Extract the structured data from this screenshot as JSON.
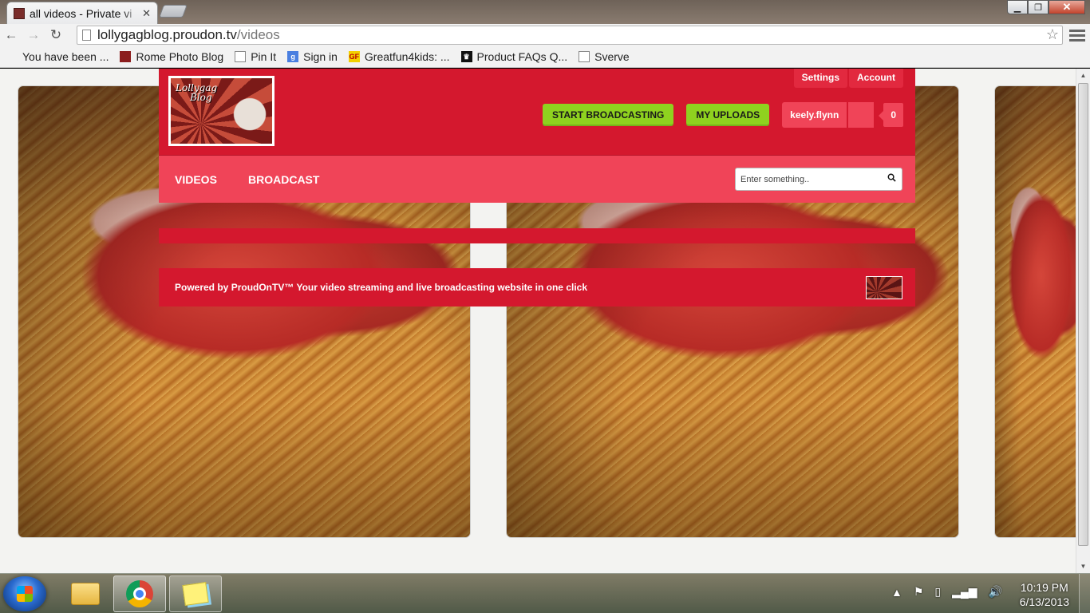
{
  "browser": {
    "tab_title": "all videos - Private vi",
    "tab_close": "✕",
    "url_host": "lollygagblog.proudon.tv",
    "url_path": "/videos",
    "window_close": "✕",
    "window_min": "▁",
    "window_max": "❐"
  },
  "bookmarks": [
    {
      "label": "You have been ...",
      "icon": "none"
    },
    {
      "label": "Rome Photo Blog",
      "icon": "photo-icon"
    },
    {
      "label": "Pin It",
      "icon": "page-icon"
    },
    {
      "label": "Sign in",
      "icon": "google-icon",
      "glyph": "g"
    },
    {
      "label": "Greatfun4kids: ...",
      "icon": "gf-icon",
      "glyph": "GF"
    },
    {
      "label": "Product FAQs Q...",
      "icon": "faq-icon",
      "glyph": "♛"
    },
    {
      "label": "Sverve",
      "icon": "page-icon"
    }
  ],
  "site": {
    "logo_text_line1": "Lollygag",
    "logo_text_line2": "Blog",
    "settings": "Settings",
    "account": "Account",
    "start_broadcasting": "START BROADCASTING",
    "my_uploads": "MY UPLOADS",
    "username": "keely.flynn",
    "notification_count": "0",
    "nav_videos": "VIDEOS",
    "nav_broadcast": "BROADCAST",
    "search_placeholder": "Enter something..",
    "footer_text": "Powered by ProudOnTV™ Your video streaming and live broadcasting website in one click"
  },
  "taskbar": {
    "time": "10:19 PM",
    "date": "6/13/2013",
    "tray_icons": [
      "▲",
      "⚑",
      "▯",
      "▂▄▆",
      "🔊"
    ]
  },
  "colors": {
    "brand_red": "#d4182e",
    "nav_pink": "#f04458",
    "button_green": "#8fd21f"
  }
}
